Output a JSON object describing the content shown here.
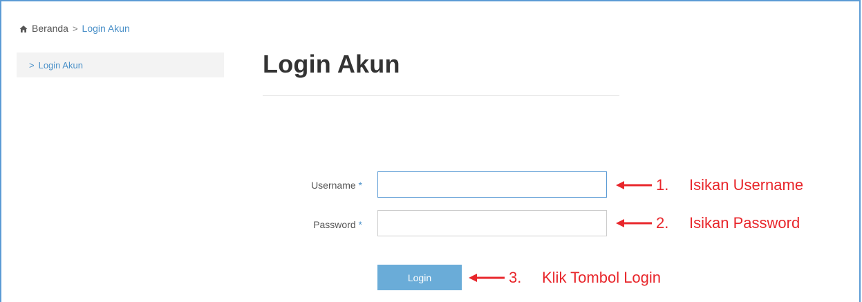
{
  "breadcrumb": {
    "home_label": "Beranda",
    "separator": ">",
    "current": "Login Akun"
  },
  "sidebar": {
    "items": [
      {
        "chevron": ">",
        "label": "Login Akun"
      }
    ]
  },
  "main": {
    "title": "Login Akun",
    "form": {
      "username_label": "Username",
      "password_label": "Password",
      "required_marker": "*",
      "username_value": "",
      "password_value": "",
      "login_button": "Login"
    }
  },
  "annotations": [
    {
      "number": "1.",
      "text": "Isikan Username"
    },
    {
      "number": "2.",
      "text": "Isikan Password"
    },
    {
      "number": "3.",
      "text": "Klik Tombol Login"
    }
  ],
  "colors": {
    "accent": "#4a90c8",
    "button": "#6aacd8",
    "annotation": "#e8262b",
    "frame": "#5b9bd5"
  },
  "icons": [
    "home-icon",
    "chevron-right-icon",
    "arrow-left-icon"
  ]
}
